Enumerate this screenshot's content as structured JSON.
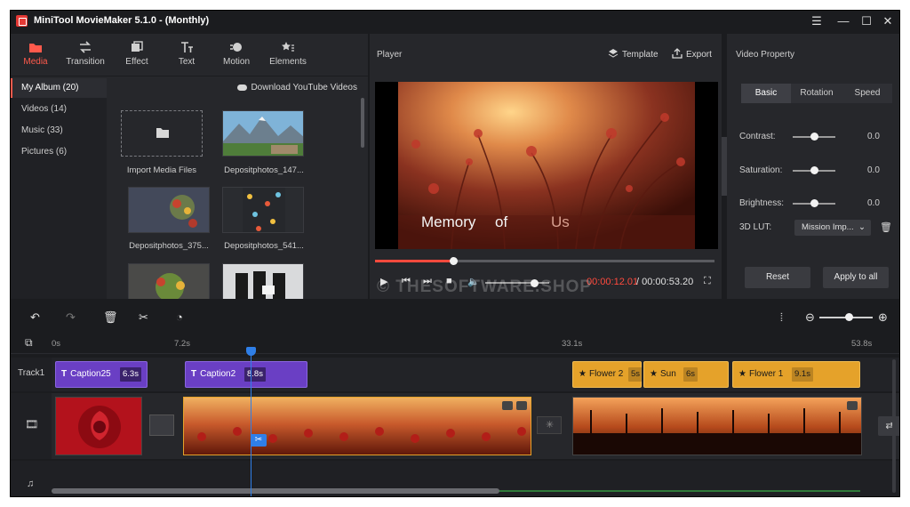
{
  "window": {
    "title": "MiniTool MovieMaker 5.1.0 - (Monthly)"
  },
  "toolbar": {
    "tabs": [
      {
        "label": "Media",
        "icon": "folder-icon"
      },
      {
        "label": "Transition",
        "icon": "transition-icon"
      },
      {
        "label": "Effect",
        "icon": "effect-icon"
      },
      {
        "label": "Text",
        "icon": "text-icon"
      },
      {
        "label": "Motion",
        "icon": "motion-icon"
      },
      {
        "label": "Elements",
        "icon": "elements-icon"
      }
    ],
    "active": "Media"
  },
  "album": {
    "items": [
      "My Album (20)",
      "Videos (14)",
      "Music (33)",
      "Pictures (6)"
    ],
    "download_link": "Download YouTube Videos"
  },
  "media": {
    "items": [
      "Import Media Files",
      "Depositphotos_147...",
      "Depositphotos_375...",
      "Depositphotos_541..."
    ]
  },
  "player": {
    "title": "Player",
    "template_label": "Template",
    "export_label": "Export",
    "caption_words": [
      "Memory",
      "of",
      "Us"
    ],
    "progress": 0.23,
    "volume": 0.76,
    "current_time": "00:00:12.01",
    "total_time": "/ 00:00:53.20"
  },
  "property": {
    "title": "Video Property",
    "tabs": [
      "Basic",
      "Rotation",
      "Speed"
    ],
    "active_tab": "Basic",
    "rows": [
      {
        "label": "Contrast:",
        "value": "0.0"
      },
      {
        "label": "Saturation:",
        "value": "0.0"
      },
      {
        "label": "Brightness:",
        "value": "0.0"
      }
    ],
    "lut_label": "3D LUT:",
    "lut_value": "Mission Imp...",
    "reset_label": "Reset",
    "apply_label": "Apply to all"
  },
  "timeline": {
    "ruler": [
      "0s",
      "7.2s",
      "33.1s",
      "53.8s"
    ],
    "track1_label": "Track1",
    "captions": [
      {
        "label": "Caption25",
        "duration": "6.3s",
        "color": "purple"
      },
      {
        "label": "Caption2",
        "duration": "8.8s",
        "color": "purple"
      },
      {
        "label": "Flower 2",
        "duration": "5s",
        "color": "gold"
      },
      {
        "label": "Sun",
        "duration": "6s",
        "color": "gold"
      },
      {
        "label": "Flower 1",
        "duration": "9.1s",
        "color": "gold"
      }
    ],
    "zoom": 0.55
  },
  "watermark": "© THESOFTWARE.SHOP",
  "colors": {
    "accent": "#ff4a3d",
    "purple_clip": "#6a3fc4",
    "gold_clip": "#e5a22a",
    "playhead": "#2f7fe8"
  }
}
